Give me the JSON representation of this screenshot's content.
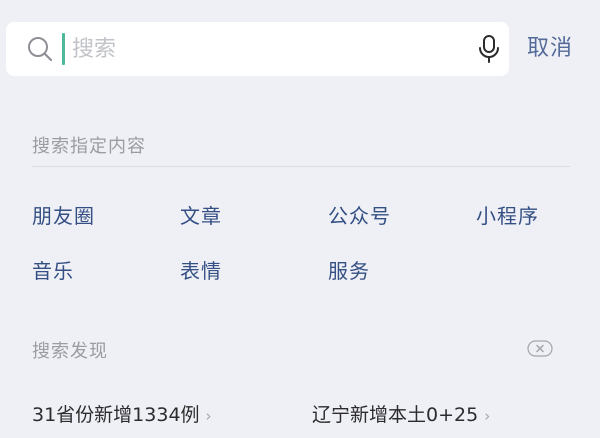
{
  "search": {
    "placeholder": "搜索",
    "cancel_label": "取消"
  },
  "search_scope": {
    "title": "搜索指定内容",
    "categories": [
      {
        "label": "朋友圈"
      },
      {
        "label": "文章"
      },
      {
        "label": "公众号"
      },
      {
        "label": "小程序"
      },
      {
        "label": "音乐"
      },
      {
        "label": "表情"
      },
      {
        "label": "服务"
      }
    ]
  },
  "discover": {
    "title": "搜索发现",
    "items": [
      {
        "label": "31省份新增1334例"
      },
      {
        "label": "辽宁新增本土0+25"
      }
    ]
  },
  "icons": {
    "search": "search-icon",
    "mic": "microphone-icon",
    "clear": "clear-icon",
    "chevron": "chevron-right-icon"
  },
  "colors": {
    "background": "#eff0f5",
    "accent_link": "#546a99",
    "category_text": "#344f84",
    "cursor": "#4fb89a",
    "muted_text": "#9a9ca3"
  }
}
